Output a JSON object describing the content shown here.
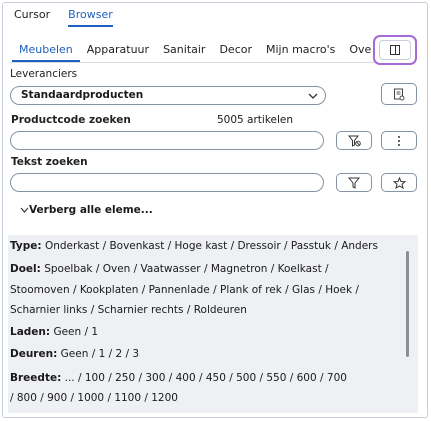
{
  "mode_tabs": {
    "cursor": "Cursor",
    "browser": "Browser"
  },
  "category_tabs": [
    "Meubelen",
    "Apparatuur",
    "Sanitair",
    "Decor",
    "Mijn macro's",
    "Overig"
  ],
  "suppliers": {
    "label": "Leveranciers",
    "selected": "Standaardproducten"
  },
  "product_code": {
    "label": "Productcode zoeken",
    "count": "5005 artikelen",
    "value": ""
  },
  "text_search": {
    "label": "Tekst zoeken",
    "value": ""
  },
  "hide_toggle": "Verberg alle eleme...",
  "properties": {
    "type_label": "Type:",
    "type_values": "Onderkast / Bovenkast / Hoge kast / Dressoir / Passtuk / Anders",
    "doel_label": "Doel:",
    "doel_line1": "Spoelbak / Oven / Vaatwasser / Magnetron / Koelkast /",
    "doel_line2": "Stoomoven / Kookplaten / Pannenlade / Plank of rek / Glas / Hoek /",
    "doel_line3": "Scharnier links / Scharnier rechts / Roldeuren",
    "laden_label": "Laden:",
    "laden_values": "Geen / 1",
    "deuren_label": "Deuren:",
    "deuren_values": "Geen / 1 / 2 / 3",
    "breedte_label": "Breedte:",
    "breedte_line1": "... / 100 / 250 / 300 / 400 / 450 / 500 / 550 / 600 / 700",
    "breedte_line2": "/ 800 / 900 / 1000 / 1100 / 1200"
  },
  "colors": {
    "accent": "#1f5fbf",
    "highlight": "#a46ad8"
  }
}
